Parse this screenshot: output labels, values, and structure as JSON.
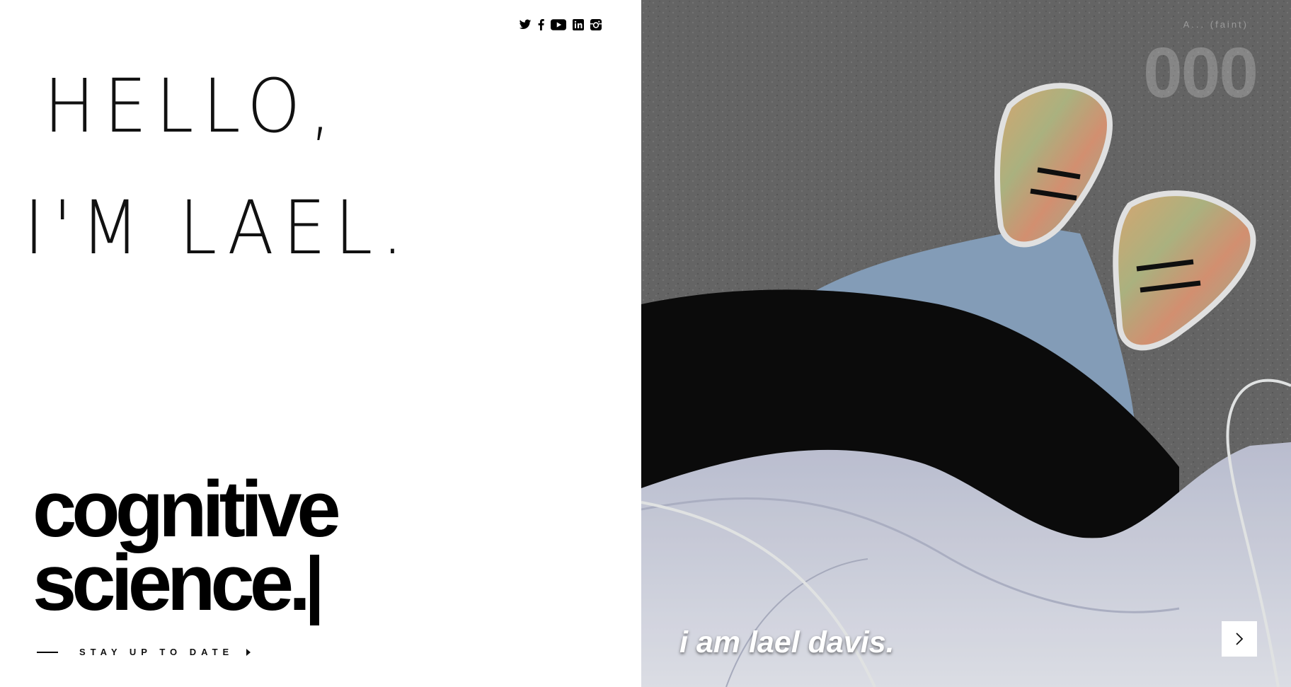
{
  "social": [
    {
      "name": "twitter-icon"
    },
    {
      "name": "facebook-icon"
    },
    {
      "name": "youtube-icon"
    },
    {
      "name": "linkedin-icon"
    },
    {
      "name": "instagram-icon"
    }
  ],
  "hero": {
    "greeting_line1": "Hello,",
    "greeting_line2": "I'm Lael.",
    "headline_line1": "cognitive",
    "headline_line2": "science."
  },
  "cta": {
    "label": "STAY UP TO DATE"
  },
  "slider": {
    "counter_small": "A... (faint)",
    "counter_big": "000",
    "caption": "i am lael davis."
  },
  "colors": {
    "background": "#ffffff",
    "text": "#000000",
    "asphalt": "#6e6e6e"
  }
}
